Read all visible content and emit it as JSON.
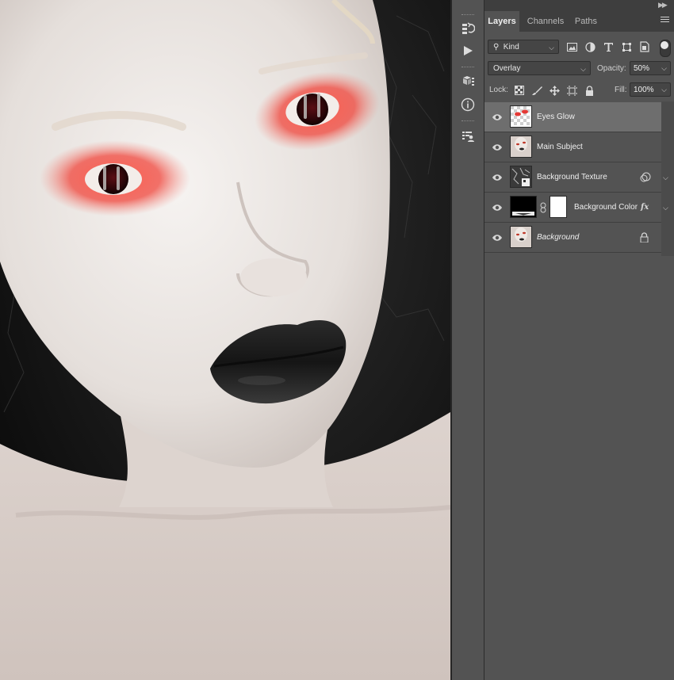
{
  "panel": {
    "tabs": [
      {
        "label": "Layers",
        "active": true
      },
      {
        "label": "Channels",
        "active": false
      },
      {
        "label": "Paths",
        "active": false
      }
    ],
    "filter_kind": "Kind",
    "blend_mode": "Overlay",
    "opacity_label": "Opacity:",
    "opacity_value": "50%",
    "lock_label": "Lock:",
    "fill_label": "Fill:",
    "fill_value": "100%",
    "layers": [
      {
        "name": "Eyes Glow",
        "selected": true,
        "italic": false,
        "thumb": "transparent-eyes"
      },
      {
        "name": "Main Subject",
        "selected": false,
        "italic": false,
        "thumb": "portrait"
      },
      {
        "name": "Background Texture",
        "selected": false,
        "italic": false,
        "thumb": "texture",
        "tail_icon": "clipping-icon"
      },
      {
        "name": "Background Color",
        "selected": false,
        "italic": false,
        "thumb": "black-fill",
        "has_mask": true,
        "tail_icon": "fx-icon"
      },
      {
        "name": "Background",
        "selected": false,
        "italic": true,
        "thumb": "portrait",
        "tail_icon": "lock-icon"
      }
    ]
  },
  "toolstrip": [
    "history-icon",
    "play-action-icon",
    "3d-cube-icon",
    "info-icon",
    "properties-icon"
  ],
  "colors": {
    "panel_bg": "#535353",
    "dark_bg": "#3e3e3e",
    "selected_row": "#6e6e6e",
    "eye_glow": "#e53935"
  }
}
